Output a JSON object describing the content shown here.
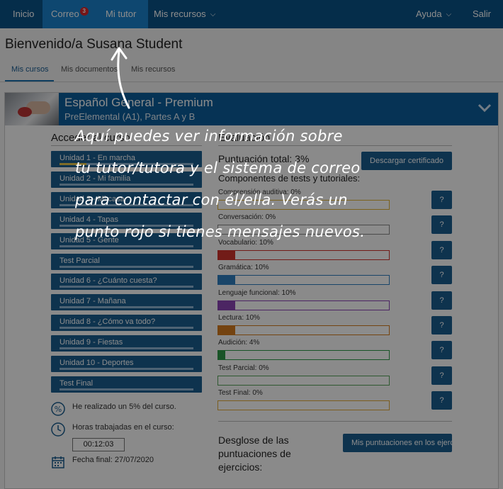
{
  "nav": {
    "inicio": "Inicio",
    "correo": "Correo",
    "correo_badge": "3",
    "mi_tutor": "Mi tutor",
    "mis_recursos": "Mis recursos",
    "ayuda": "Ayuda",
    "salir": "Salir"
  },
  "page": {
    "title": "Bienvenido/a Susana Student",
    "tabs": [
      "Mis cursos",
      "Mis documentos",
      "Mis recursos"
    ]
  },
  "course": {
    "title": "Español General - Premium",
    "subtitle": "PreElemental (A1), Partes A y B",
    "access_heading": "Acceder al curso",
    "units": [
      {
        "label": "Unidad 1 - En marcha",
        "progress": 0.2
      },
      {
        "label": "Unidad 2 - Mi familia",
        "progress": 0
      },
      {
        "label": "Unidad 3 - Mi casa",
        "progress": 0
      },
      {
        "label": "Unidad 4 - Tapas",
        "progress": 0
      },
      {
        "label": "Unidad 5 - Gente",
        "progress": 0
      },
      {
        "label": "Test Parcial",
        "progress": 0
      },
      {
        "label": "Unidad 6 - ¿Cuánto cuesta?",
        "progress": 0
      },
      {
        "label": "Unidad 7 - Mañana",
        "progress": 0
      },
      {
        "label": "Unidad 8 - ¿Cómo va todo?",
        "progress": 0
      },
      {
        "label": "Unidad 9 - Fiestas",
        "progress": 0
      },
      {
        "label": "Unidad 10 - Deportes",
        "progress": 0
      },
      {
        "label": "Test Final",
        "progress": 0
      }
    ],
    "stats": {
      "percent_done": "He realizado un 5% del curso.",
      "hours_label": "Horas trabajadas en el curso:",
      "hours_value": "00:12:03",
      "end_date": "Fecha final: 27/07/2020"
    }
  },
  "evaluation": {
    "heading": "Evaluación",
    "total": "Puntuación total: 3%",
    "certificate_button": "Descargar certificado",
    "components_label": "Componentes de tests y tutoriales:",
    "components": [
      {
        "label": "Comprensión auditiva: 0%",
        "value": 0,
        "color": "#e0b23a"
      },
      {
        "label": "Conversación: 0%",
        "value": 0,
        "color": "#888888"
      },
      {
        "label": "Vocabulario: 10%",
        "value": 10,
        "color": "#d0342c"
      },
      {
        "label": "Gramática: 10%",
        "value": 10,
        "color": "#2f7fc0"
      },
      {
        "label": "Lenguaje funcional: 10%",
        "value": 10,
        "color": "#8a44b5"
      },
      {
        "label": "Lectura: 10%",
        "value": 10,
        "color": "#d37a1e"
      },
      {
        "label": "Audición: 4%",
        "value": 4,
        "color": "#2f9a48"
      },
      {
        "label": "Test Parcial: 0%",
        "value": 0,
        "color": "#56a35a"
      },
      {
        "label": "Test Final: 0%",
        "value": 0,
        "color": "#e0a93a"
      }
    ],
    "help_label": "?",
    "breakdown_lines": [
      "Desglose de las",
      "puntuaciones de",
      "ejercicios:"
    ],
    "breakdown_button": "Mis puntuaciones en los ejercicios"
  },
  "overlay": {
    "lines": [
      "Aquí puedes ver información sobre",
      "tu tutor/tutora y el sistema de correo",
      "para contactar con él/ella. Verás un",
      "punto rojo si tienes mensajes nuevos."
    ]
  }
}
